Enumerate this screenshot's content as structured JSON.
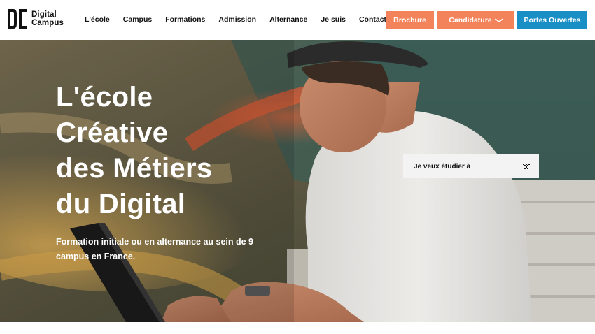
{
  "logo": {
    "line1": "Digital",
    "line2": "Campus",
    "icon": "dc-monogram-icon"
  },
  "nav": {
    "items": [
      {
        "label": "L'école"
      },
      {
        "label": "Campus"
      },
      {
        "label": "Formations"
      },
      {
        "label": "Admission"
      },
      {
        "label": "Alternance"
      },
      {
        "label": "Je suis"
      },
      {
        "label": "Contact"
      }
    ]
  },
  "buttons": {
    "brochure": "Brochure",
    "candidature": "Candidature",
    "candidature_icon": "chevron-down-icon",
    "portes_ouvertes": "Portes Ouvertes"
  },
  "hero": {
    "title_lines": [
      "L'école",
      "Créative",
      "des Métiers",
      "du Digital"
    ],
    "subtitle": "Formation initiale ou en alternance au sein de 9 campus en France.",
    "select_label": "Je veux étudier à",
    "select_icon": "pixel-arrow-icon"
  },
  "colors": {
    "accent_orange": "#f2835a",
    "accent_blue": "#1a8fc6",
    "text_dark": "#111111",
    "white": "#ffffff"
  }
}
